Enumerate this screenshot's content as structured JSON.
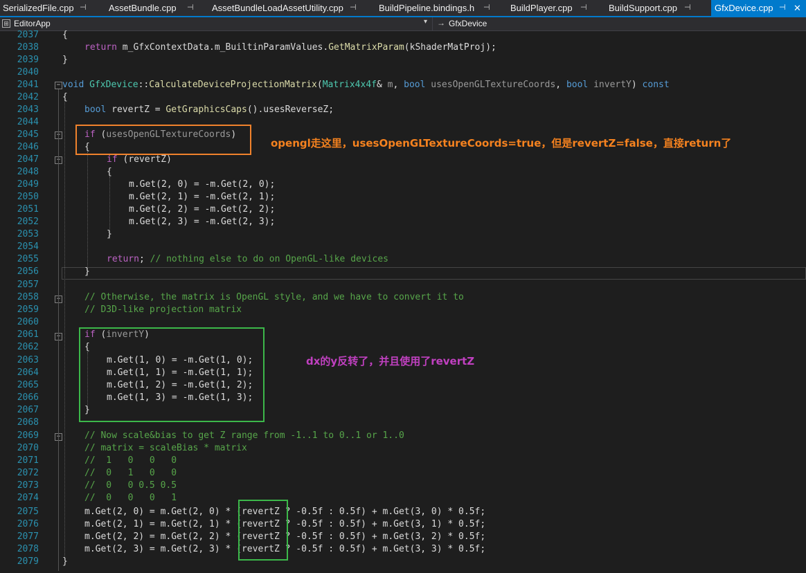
{
  "tabs": [
    {
      "label": "SerializedFile.cpp"
    },
    {
      "label": "AssetBundle.cpp"
    },
    {
      "label": "AssetBundleLoadAssetUtility.cpp"
    },
    {
      "label": "BuildPipeline.bindings.h"
    },
    {
      "label": "BuildPlayer.cpp"
    },
    {
      "label": "BuildSupport.cpp"
    },
    {
      "label": "GfxDevice.cpp"
    }
  ],
  "navbar": {
    "project": "EditorApp",
    "scope": "GfxDevice"
  },
  "line_numbers": [
    "2037",
    "2038",
    "2039",
    "2040",
    "2041",
    "2042",
    "2043",
    "2044",
    "2045",
    "2046",
    "2047",
    "2048",
    "2049",
    "2050",
    "2051",
    "2052",
    "2053",
    "2054",
    "2055",
    "2056",
    "2057",
    "2058",
    "2059",
    "2060",
    "2061",
    "2062",
    "2063",
    "2064",
    "2065",
    "2066",
    "2067",
    "2068",
    "2069",
    "2070",
    "2071",
    "2072",
    "2073",
    "2074",
    "2075",
    "2076",
    "2077",
    "2078",
    "2079"
  ],
  "code": {
    "l2037": "{",
    "l2038_kw": "return",
    "l2038_a": "m_GfxContextData.m_BuiltinParamValues.",
    "l2038_fn": "GetMatrixParam",
    "l2038_b": "(kShaderMatProj);",
    "l2039": "}",
    "l2041_void": "void",
    "l2041_cls": "GfxDevice",
    "l2041_sep": "::",
    "l2041_fn": "CalculateDeviceProjectionMatrix",
    "l2041_p1": "(",
    "l2041_ty": "Matrix4x4f",
    "l2041_p2": "& ",
    "l2041_m": "m",
    "l2041_p3": ", ",
    "l2041_bool1": "bool",
    "l2041_arg1": "usesOpenGLTextureCoords",
    "l2041_p4": ", ",
    "l2041_bool2": "bool",
    "l2041_arg2": "invertY",
    "l2041_p5": ") ",
    "l2041_const": "const",
    "l2042": "{",
    "l2043_bool": "bool",
    "l2043_var": "revertZ",
    "l2043_a": " = ",
    "l2043_fn": "GetGraphicsCaps",
    "l2043_b": "().usesReverseZ;",
    "l2045_if": "if",
    "l2045_a": " (",
    "l2045_arg": "usesOpenGLTextureCoords",
    "l2045_b": ")",
    "l2046": "{",
    "l2047_if": "if",
    "l2047_a": " (",
    "l2047_var": "revertZ",
    "l2047_b": ")",
    "l2048": "{",
    "l2049": "m.Get(2, 0) = -m.Get(2, 0);",
    "l2050": "m.Get(2, 1) = -m.Get(2, 1);",
    "l2051": "m.Get(2, 2) = -m.Get(2, 2);",
    "l2052": "m.Get(2, 3) = -m.Get(2, 3);",
    "l2053": "}",
    "l2055_kw": "return",
    "l2055_a": "; ",
    "l2055_cm": "// nothing else to do on OpenGL-like devices",
    "l2056": "}",
    "l2058": "// Otherwise, the matrix is OpenGL style, and we have to convert it to",
    "l2059": "// D3D-like projection matrix",
    "l2061_if": "if",
    "l2061_a": " (",
    "l2061_arg": "invertY",
    "l2061_b": ")",
    "l2062": "{",
    "l2063": "m.Get(1, 0) = -m.Get(1, 0);",
    "l2064": "m.Get(1, 1) = -m.Get(1, 1);",
    "l2065": "m.Get(1, 2) = -m.Get(1, 2);",
    "l2066": "m.Get(1, 3) = -m.Get(1, 3);",
    "l2067": "}",
    "l2069": "// Now scale&bias to get Z range from -1..1 to 0..1 or 1..0",
    "l2070": "// matrix = scaleBias * matrix",
    "l2071": "//  1   0   0   0",
    "l2072": "//  0   1   0   0",
    "l2073": "//  0   0 0.5 0.5",
    "l2074": "//  0   0   0   1",
    "l2075_a": "m.Get(2, 0) = m.Get(2, 0) * (",
    "l2075_var": "revertZ",
    "l2075_b": " ? -0.5f : 0.5f) + m.Get(3, 0) * 0.5f;",
    "l2076_a": "m.Get(2, 1) = m.Get(2, 1) * (",
    "l2076_var": "revertZ",
    "l2076_b": " ? -0.5f : 0.5f) + m.Get(3, 1) * 0.5f;",
    "l2077_a": "m.Get(2, 2) = m.Get(2, 2) * (",
    "l2077_var": "revertZ",
    "l2077_b": " ? -0.5f : 0.5f) + m.Get(3, 2) * 0.5f;",
    "l2078_a": "m.Get(2, 3) = m.Get(2, 3) * (",
    "l2078_var": "revertZ",
    "l2078_b": " ? -0.5f : 0.5f) + m.Get(3, 3) * 0.5f;",
    "l2079": "}"
  },
  "annotations": {
    "opengl": "opengl走这里，usesOpenGLTextureCoords=true，但是revertZ=false，直接return了",
    "dx": "dx的y反转了，并且使用了revertZ"
  },
  "colors": {
    "background": "#1e1e1e",
    "accent": "#007acc",
    "orange_box": "#f0822c",
    "green_box": "#3cb84a",
    "opengl_annotation": "#f5821f",
    "dx_annotation": "#c040c0"
  }
}
